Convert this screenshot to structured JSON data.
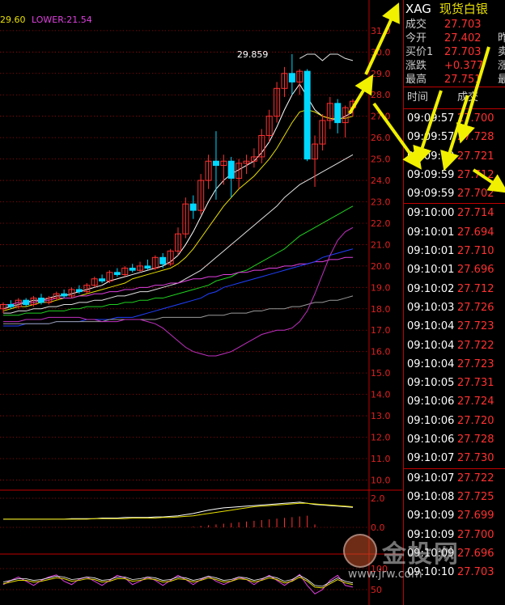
{
  "legend": {
    "upper": "29.60",
    "lower_label": "LOWER:",
    "lower": "21.54"
  },
  "chart_data": {
    "type": "candlestick",
    "price_axis": {
      "ticks": [
        "31.0",
        "30.0",
        "29.0",
        "28.0",
        "27.0",
        "26.0",
        "25.0",
        "24.0",
        "23.0",
        "22.0",
        "21.0",
        "20.0",
        "19.0",
        "18.0",
        "17.0",
        "16.0",
        "15.0",
        "14.0",
        "13.0",
        "12.0",
        "11.0",
        "10.0"
      ],
      "range": [
        9.6,
        31.6
      ]
    },
    "max_label": "29.859",
    "macd_axis": {
      "ticks": [
        "2.0",
        "0.0"
      ]
    },
    "osc_axis": {
      "ticks": [
        "100",
        "50"
      ]
    },
    "candles": [
      [
        18.0,
        18.3,
        17.8,
        18.2
      ],
      [
        18.2,
        18.4,
        18.0,
        18.1
      ],
      [
        18.1,
        18.5,
        18.0,
        18.4
      ],
      [
        18.4,
        18.5,
        18.1,
        18.2
      ],
      [
        18.2,
        18.6,
        18.1,
        18.5
      ],
      [
        18.5,
        18.7,
        18.2,
        18.3
      ],
      [
        18.3,
        18.6,
        18.2,
        18.5
      ],
      [
        18.5,
        18.8,
        18.4,
        18.7
      ],
      [
        18.7,
        18.9,
        18.5,
        18.6
      ],
      [
        18.6,
        19.0,
        18.5,
        18.9
      ],
      [
        18.9,
        19.1,
        18.7,
        18.8
      ],
      [
        18.8,
        19.2,
        18.7,
        19.1
      ],
      [
        19.1,
        19.5,
        19.0,
        19.4
      ],
      [
        19.4,
        19.6,
        19.2,
        19.3
      ],
      [
        19.3,
        19.8,
        19.2,
        19.7
      ],
      [
        19.7,
        19.9,
        19.5,
        19.6
      ],
      [
        19.6,
        20.0,
        19.5,
        19.9
      ],
      [
        19.9,
        20.1,
        19.7,
        19.8
      ],
      [
        19.8,
        20.2,
        19.7,
        20.0
      ],
      [
        20.0,
        20.3,
        19.8,
        19.9
      ],
      [
        19.9,
        20.5,
        19.8,
        20.4
      ],
      [
        20.4,
        20.6,
        19.9,
        20.1
      ],
      [
        20.1,
        20.8,
        20.0,
        20.7
      ],
      [
        20.7,
        21.8,
        20.5,
        21.5
      ],
      [
        21.5,
        23.2,
        21.3,
        22.9
      ],
      [
        22.9,
        23.3,
        22.2,
        22.6
      ],
      [
        22.6,
        24.3,
        22.4,
        24.0
      ],
      [
        24.0,
        25.2,
        23.6,
        24.9
      ],
      [
        24.9,
        26.3,
        23.1,
        24.7
      ],
      [
        24.7,
        25.2,
        23.8,
        24.9
      ],
      [
        24.9,
        25.1,
        23.2,
        24.1
      ],
      [
        24.1,
        25.0,
        23.6,
        24.8
      ],
      [
        24.8,
        25.2,
        24.3,
        24.9
      ],
      [
        24.9,
        25.5,
        24.6,
        25.1
      ],
      [
        25.1,
        26.4,
        24.8,
        26.1
      ],
      [
        26.1,
        27.3,
        25.8,
        27.0
      ],
      [
        27.0,
        28.6,
        26.7,
        28.3
      ],
      [
        28.3,
        29.3,
        27.9,
        29.0
      ],
      [
        29.0,
        29.9,
        28.0,
        28.6
      ],
      [
        28.6,
        29.2,
        28.0,
        29.1
      ],
      [
        29.1,
        29.2,
        24.9,
        25.0
      ],
      [
        25.0,
        26.1,
        23.7,
        25.7
      ],
      [
        25.7,
        27.1,
        25.4,
        26.8
      ],
      [
        26.8,
        27.9,
        26.4,
        27.6
      ],
      [
        27.6,
        27.8,
        26.2,
        26.7
      ],
      [
        26.7,
        27.5,
        26.0,
        27.4
      ],
      [
        27.4,
        27.8,
        27.0,
        27.7
      ]
    ],
    "ma_lines": [
      {
        "name": "",
        "color": "#ffffff",
        "values": [
          18.0,
          18.1,
          18.2,
          18.3,
          18.4,
          18.4,
          18.5,
          18.6,
          18.6,
          18.7,
          18.8,
          18.9,
          19.0,
          19.1,
          19.3,
          19.4,
          19.5,
          19.6,
          19.7,
          19.8,
          19.9,
          20.0,
          20.2,
          20.5,
          21.0,
          21.6,
          22.3,
          23.0,
          23.6,
          24.0,
          24.3,
          24.5,
          24.7,
          24.9,
          25.3,
          25.8,
          26.5,
          27.3,
          28.0,
          28.5,
          27.9,
          27.3,
          27.0,
          26.9,
          26.8,
          27.0,
          27.2
        ]
      },
      {
        "name": "",
        "color": "#e8e000",
        "values": [
          17.9,
          18.0,
          18.1,
          18.1,
          18.2,
          18.3,
          18.3,
          18.4,
          18.5,
          18.5,
          18.6,
          18.7,
          18.8,
          18.9,
          19.0,
          19.1,
          19.2,
          19.4,
          19.5,
          19.6,
          19.7,
          19.8,
          19.9,
          20.1,
          20.4,
          20.8,
          21.3,
          21.8,
          22.3,
          22.8,
          23.2,
          23.6,
          23.9,
          24.2,
          24.6,
          25.0,
          25.5,
          26.1,
          26.7,
          27.2,
          27.3,
          27.2,
          27.0,
          26.9,
          26.9,
          26.9,
          27.0
        ]
      },
      {
        "name": "",
        "color": "#e0e0e0",
        "values": [
          17.8,
          17.8,
          17.9,
          17.9,
          18.0,
          18.0,
          18.1,
          18.1,
          18.2,
          18.2,
          18.3,
          18.3,
          18.4,
          18.4,
          18.5,
          18.6,
          18.6,
          18.7,
          18.8,
          18.8,
          18.9,
          19.0,
          19.1,
          19.2,
          19.4,
          19.6,
          19.8,
          20.1,
          20.4,
          20.7,
          21.0,
          21.3,
          21.6,
          21.9,
          22.2,
          22.5,
          22.8,
          23.2,
          23.5,
          23.8,
          24.0,
          24.2,
          24.4,
          24.6,
          24.8,
          25.0,
          25.2
        ]
      },
      {
        "name": "",
        "color": "#20d020",
        "values": [
          17.7,
          17.7,
          17.7,
          17.8,
          17.8,
          17.8,
          17.9,
          17.9,
          17.9,
          18.0,
          18.0,
          18.1,
          18.1,
          18.1,
          18.2,
          18.2,
          18.3,
          18.3,
          18.4,
          18.4,
          18.5,
          18.5,
          18.6,
          18.7,
          18.8,
          18.9,
          19.0,
          19.1,
          19.3,
          19.4,
          19.5,
          19.7,
          19.8,
          20.0,
          20.2,
          20.4,
          20.6,
          20.8,
          21.1,
          21.4,
          21.6,
          21.8,
          22.0,
          22.2,
          22.4,
          22.6,
          22.8
        ]
      },
      {
        "name": "",
        "color": "#e040e0",
        "values": [
          18.2,
          18.2,
          18.3,
          18.3,
          18.3,
          18.4,
          18.4,
          18.5,
          18.5,
          18.5,
          18.6,
          18.6,
          18.7,
          18.7,
          18.8,
          18.8,
          18.9,
          18.9,
          19.0,
          19.0,
          19.1,
          19.1,
          19.2,
          19.2,
          19.3,
          19.4,
          19.4,
          19.5,
          19.5,
          19.6,
          19.6,
          19.7,
          19.7,
          19.8,
          19.8,
          19.9,
          19.9,
          20.0,
          20.0,
          20.1,
          20.1,
          20.2,
          20.2,
          20.3,
          20.3,
          20.4,
          20.4
        ]
      },
      {
        "name": "",
        "color": "#2040ff",
        "values": [
          17.2,
          17.2,
          17.2,
          17.3,
          17.3,
          17.3,
          17.3,
          17.4,
          17.4,
          17.4,
          17.4,
          17.5,
          17.5,
          17.5,
          17.5,
          17.6,
          17.6,
          17.6,
          17.7,
          17.8,
          17.9,
          18.0,
          18.1,
          18.2,
          18.3,
          18.4,
          18.5,
          18.7,
          18.8,
          19.0,
          19.1,
          19.2,
          19.3,
          19.4,
          19.5,
          19.6,
          19.7,
          19.8,
          19.9,
          20.0,
          20.1,
          20.2,
          20.4,
          20.5,
          20.6,
          20.7,
          20.8
        ]
      },
      {
        "name": "",
        "color": "#9a9a9a",
        "values": [
          17.3,
          17.3,
          17.3,
          17.3,
          17.3,
          17.3,
          17.3,
          17.4,
          17.4,
          17.4,
          17.4,
          17.4,
          17.4,
          17.4,
          17.5,
          17.5,
          17.5,
          17.5,
          17.5,
          17.5,
          17.5,
          17.6,
          17.6,
          17.6,
          17.6,
          17.6,
          17.6,
          17.7,
          17.7,
          17.7,
          17.8,
          17.8,
          17.8,
          17.9,
          17.9,
          18.0,
          18.0,
          18.0,
          18.1,
          18.1,
          18.2,
          18.3,
          18.3,
          18.4,
          18.4,
          18.5,
          18.6
        ]
      },
      {
        "name": "",
        "color": "#c030c0",
        "values": [
          17.4,
          17.4,
          17.4,
          17.5,
          17.5,
          17.5,
          17.6,
          17.6,
          17.6,
          17.6,
          17.6,
          17.5,
          17.5,
          17.4,
          17.4,
          17.4,
          17.5,
          17.5,
          17.5,
          17.4,
          17.3,
          17.1,
          16.8,
          16.5,
          16.2,
          16.0,
          15.9,
          15.8,
          15.8,
          15.9,
          16.0,
          16.2,
          16.4,
          16.6,
          16.8,
          16.9,
          17.0,
          17.0,
          17.1,
          17.4,
          17.9,
          18.7,
          19.6,
          20.5,
          21.2,
          21.6,
          21.8
        ]
      }
    ],
    "bb_upper": {
      "color": "#e0e0e0",
      "values": [
        29.7,
        29.9,
        29.9,
        29.6,
        29.9,
        29.9,
        29.7,
        29.6
      ]
    },
    "macd": {
      "hist": [
        0,
        0,
        0,
        0,
        0,
        0,
        0,
        0,
        0,
        0,
        0,
        0,
        0,
        0,
        0,
        0,
        0,
        0,
        0,
        0,
        0,
        0,
        0,
        0,
        0,
        0.05,
        0.1,
        0.15,
        0.2,
        0.25,
        0.3,
        0.35,
        0.4,
        0.45,
        0.5,
        0.55,
        0.6,
        0.65,
        0.7,
        0.75,
        0.8,
        0.2,
        0,
        0,
        0,
        0,
        0
      ],
      "dif": [
        0.3,
        0.3,
        0.3,
        0.3,
        0.3,
        0.3,
        0.3,
        0.3,
        0.3,
        0.4,
        0.4,
        0.4,
        0.4,
        0.5,
        0.5,
        0.5,
        0.6,
        0.6,
        0.6,
        0.6,
        0.7,
        0.7,
        0.8,
        0.9,
        1.1,
        1.3,
        1.6,
        1.9,
        2.1,
        2.3,
        2.4,
        2.5,
        2.6,
        2.7,
        2.8,
        2.9,
        3.0,
        3.1,
        3.2,
        3.3,
        3.1,
        2.9,
        2.8,
        2.7,
        2.6,
        2.5,
        2.4
      ],
      "dea": [
        0.3,
        0.3,
        0.3,
        0.3,
        0.3,
        0.3,
        0.3,
        0.3,
        0.3,
        0.3,
        0.3,
        0.3,
        0.4,
        0.4,
        0.4,
        0.4,
        0.4,
        0.5,
        0.5,
        0.5,
        0.5,
        0.6,
        0.6,
        0.7,
        0.8,
        0.9,
        1.1,
        1.3,
        1.5,
        1.7,
        1.9,
        2.1,
        2.3,
        2.5,
        2.6,
        2.7,
        2.8,
        2.9,
        3.0,
        3.1,
        3.1,
        3.0,
        2.9,
        2.8,
        2.7,
        2.6,
        2.5
      ]
    },
    "osc": {
      "k": [
        62,
        72,
        80,
        70,
        60,
        72,
        80,
        85,
        70,
        62,
        75,
        80,
        70,
        60,
        72,
        84,
        78,
        62,
        70,
        80,
        72,
        60,
        72,
        84,
        74,
        62,
        74,
        82,
        70,
        62,
        70,
        80,
        74,
        62,
        74,
        84,
        72,
        60,
        72,
        86,
        60,
        40,
        50,
        72,
        84,
        60,
        56
      ],
      "d": [
        64,
        68,
        72,
        72,
        68,
        70,
        74,
        78,
        76,
        70,
        72,
        76,
        74,
        68,
        70,
        76,
        76,
        70,
        72,
        76,
        74,
        68,
        70,
        76,
        74,
        68,
        72,
        78,
        74,
        68,
        70,
        76,
        74,
        68,
        72,
        78,
        74,
        66,
        70,
        80,
        70,
        56,
        54,
        64,
        74,
        66,
        62
      ]
    }
  },
  "quote": {
    "code": "XAG",
    "name": "现货白银",
    "rows": [
      {
        "label": "成交",
        "value": "27.703",
        "label2": ""
      },
      {
        "label": "今开",
        "value": "27.402",
        "label2": "昨"
      },
      {
        "label": "买价1",
        "value": "27.703",
        "label2": "卖"
      },
      {
        "label": "涨跌",
        "value": "+0.377",
        "label2": "涨"
      },
      {
        "label": "最高",
        "value": "27.751",
        "label2": "最"
      }
    ]
  },
  "ticks": {
    "header": {
      "time": "时间",
      "price": "成交"
    },
    "group1": [
      {
        "time": "09:09:57",
        "price": "27.700"
      },
      {
        "time": "09:09:57",
        "price": "27.728"
      },
      {
        "time": "09:09:59",
        "price": "27.721"
      },
      {
        "time": "09:09:59",
        "price": "27.712"
      },
      {
        "time": "09:09:59",
        "price": "27.702"
      }
    ],
    "group2": [
      {
        "time": "09:10:00",
        "price": "27.714"
      },
      {
        "time": "09:10:01",
        "price": "27.694"
      },
      {
        "time": "09:10:01",
        "price": "27.710"
      },
      {
        "time": "09:10:01",
        "price": "27.696"
      },
      {
        "time": "09:10:02",
        "price": "27.712"
      },
      {
        "time": "09:10:03",
        "price": "27.726"
      },
      {
        "time": "09:10:04",
        "price": "27.723"
      },
      {
        "time": "09:10:04",
        "price": "27.722"
      },
      {
        "time": "09:10:04",
        "price": "27.723"
      },
      {
        "time": "09:10:05",
        "price": "27.731"
      },
      {
        "time": "09:10:06",
        "price": "27.724"
      },
      {
        "time": "09:10:06",
        "price": "27.720"
      },
      {
        "time": "09:10:06",
        "price": "27.728"
      },
      {
        "time": "09:10:07",
        "price": "27.730"
      }
    ],
    "group3": [
      {
        "time": "09:10:07",
        "price": "27.722"
      },
      {
        "time": "09:10:08",
        "price": "27.725"
      },
      {
        "time": "09:10:09",
        "price": "27.699"
      },
      {
        "time": "09:10:09",
        "price": "27.700"
      },
      {
        "time": "09:10:09",
        "price": "27.696"
      },
      {
        "time": "09:10:10",
        "price": "27.703"
      }
    ]
  },
  "watermark": {
    "brand": "金投网",
    "url": "www.jrw.com"
  },
  "colors": {
    "up": "#ff3030",
    "down": "#00d8ff",
    "grid": "#c00000",
    "arrow": "#f0f000"
  }
}
